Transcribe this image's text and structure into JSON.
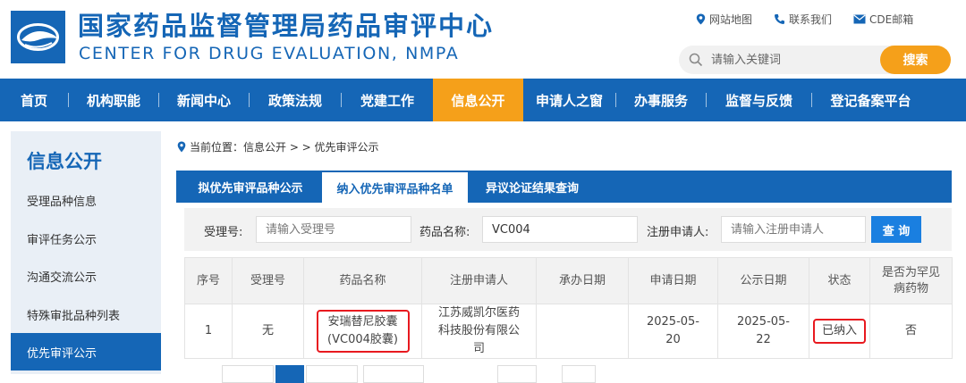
{
  "header": {
    "title_cn": "国家药品监督管理局药品审评中心",
    "title_en": "CENTER FOR DRUG EVALUATION, NMPA",
    "links": [
      {
        "label": "网站地图",
        "icon": "location-pin-icon"
      },
      {
        "label": "联系我们",
        "icon": "phone-icon"
      },
      {
        "label": "CDE邮箱",
        "icon": "mail-icon"
      }
    ],
    "search": {
      "placeholder": "请输入关键词",
      "button": "搜索"
    }
  },
  "nav": {
    "items": [
      "首页",
      "机构职能",
      "新闻中心",
      "政策法规",
      "党建工作",
      "信息公开",
      "申请人之窗",
      "办事服务",
      "监督与反馈",
      "登记备案平台"
    ],
    "active": "信息公开"
  },
  "sidebar": {
    "title": "信息公开",
    "items": [
      "受理品种信息",
      "审评任务公示",
      "沟通交流公示",
      "特殊审批品种列表",
      "优先审评公示"
    ],
    "active": "优先审评公示"
  },
  "breadcrumb": {
    "text": "当前位置：信息公开 > > 优先审评公示"
  },
  "tabs": [
    "拟优先审评品种公示",
    "纳入优先审评品种名单",
    "异议论证结果查询"
  ],
  "filter": {
    "accept_label": "受理号:",
    "accept_placeholder": "请输入受理号",
    "drug_label": "药品名称:",
    "drug_value": "VC004",
    "applicant_label": "注册申请人:",
    "applicant_placeholder": "请输入注册申请人",
    "query_button": "查 询"
  },
  "table": {
    "headers": [
      "序号",
      "受理号",
      "药品名称",
      "注册申请人",
      "承办日期",
      "申请日期",
      "公示日期",
      "状态",
      "是否为罕见病药物"
    ],
    "rows": [
      {
        "seq": "1",
        "accept_no": "无",
        "drug_name": "安瑞替尼胶囊(VC004胶囊)",
        "applicant": "江苏威凯尔医药科技股份有限公司",
        "undertake_date": "",
        "apply_date": "2025-05-20",
        "publish_date": "2025-05-22",
        "status": "已纳入",
        "rare_disease": "否"
      }
    ]
  },
  "colors": {
    "primary": "#1566b6",
    "accent": "#f5a01a",
    "highlight": "#e8191f"
  }
}
